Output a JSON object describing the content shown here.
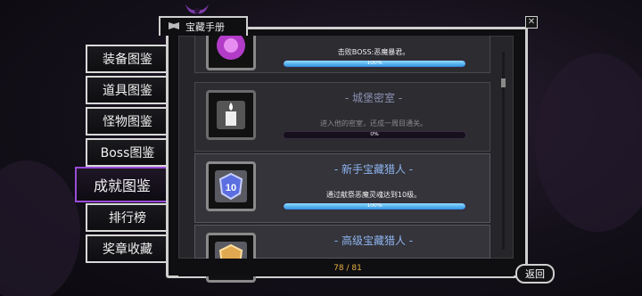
{
  "window": {
    "title": "宝藏手册"
  },
  "tabs": [
    {
      "label": "装备图鉴",
      "active": false
    },
    {
      "label": "道具图鉴",
      "active": false
    },
    {
      "label": "怪物图鉴",
      "active": false
    },
    {
      "label": "Boss图鉴",
      "active": false
    },
    {
      "label": "成就图鉴",
      "active": true
    },
    {
      "label": "排行榜",
      "active": false
    },
    {
      "label": "奖章收藏",
      "active": false
    }
  ],
  "achievements": [
    {
      "title": "",
      "description": "击败BOSS:恶魔暴君。",
      "progress_label": "100%",
      "progress": 1.0,
      "icon": "purple-demon-icon"
    },
    {
      "title": "- 城堡密室 -",
      "description": "进入他的密室，还成一周目通关。",
      "progress_label": "0%",
      "progress": 0.0,
      "icon": "candle-icon"
    },
    {
      "title": "- 新手宝藏猎人 -",
      "description": "通过献祭恶魔灵魂达到10级。",
      "progress_label": "100%",
      "progress": 1.0,
      "icon": "level-10-shield-icon"
    },
    {
      "title": "- 高级宝藏猎人 -",
      "description": "",
      "progress_label": "",
      "progress": 0.0,
      "icon": "gold-shield-icon"
    }
  ],
  "footer": {
    "page_count": "78 / 81",
    "back_label": "返回"
  },
  "colors": {
    "accent_purple": "#9a4cd8",
    "progress_blue": "#2e8fe0",
    "count_gold": "#e8b040"
  }
}
